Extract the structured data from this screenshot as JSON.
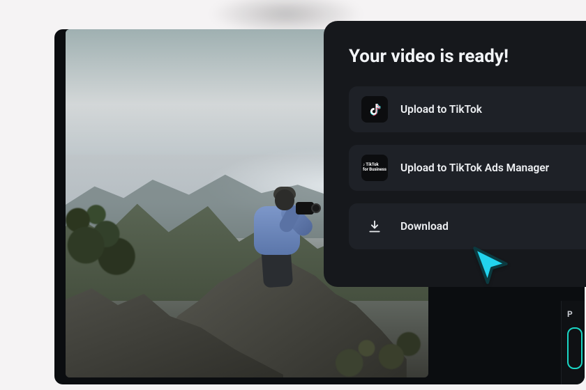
{
  "modal": {
    "title": "Your video is ready!",
    "options": [
      {
        "id": "upload-tiktok",
        "label": "Upload to TikTok",
        "icon": "tiktok-icon"
      },
      {
        "id": "upload-tiktok-ads",
        "label": "Upload to TikTok Ads Manager",
        "icon": "tiktok-business-icon"
      },
      {
        "id": "download",
        "label": "Download",
        "icon": "download-icon"
      }
    ]
  },
  "side": {
    "label_fragment": "P"
  },
  "colors": {
    "accent": "#1ad6c5",
    "panel": "#16181c",
    "option": "#1e2127"
  }
}
